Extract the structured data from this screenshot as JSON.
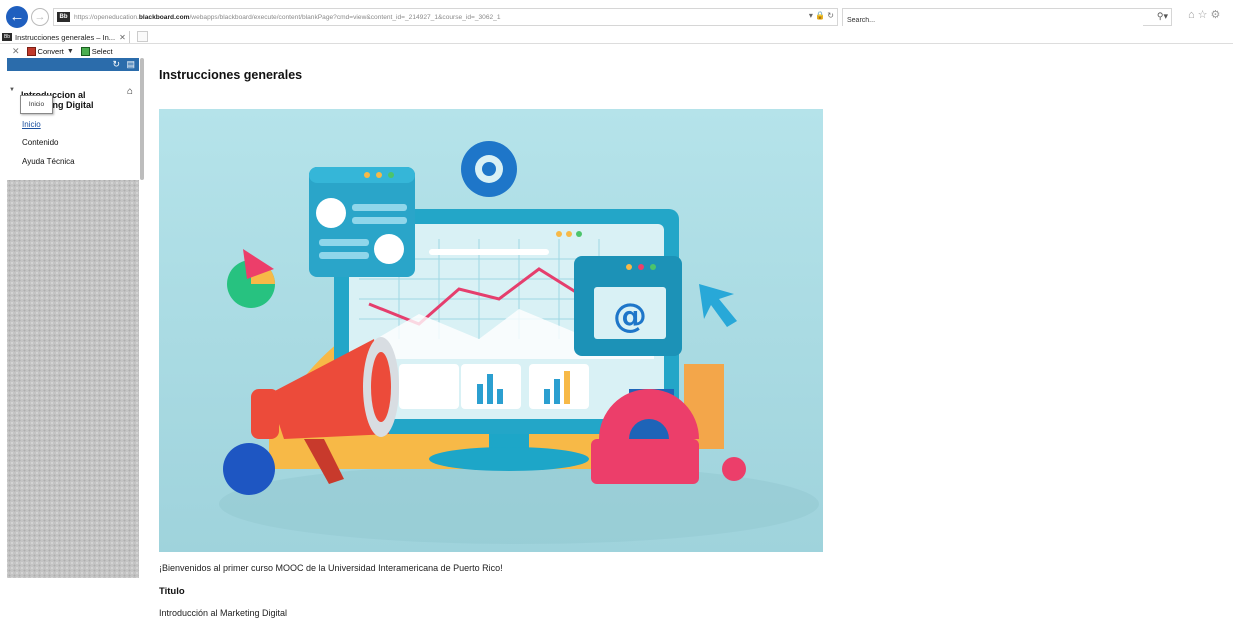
{
  "browser": {
    "url_prefix": "https://openeducation.",
    "url_domain": "blackboard.com",
    "url_path": "/webapps/blackboard/execute/content/blankPage?cmd=view&content_id=_214927_1&course_id=_3062_1",
    "search_placeholder": "Search...",
    "tab_title": "Instrucciones generales – In...",
    "favicon_text": "Bb"
  },
  "command_bar": {
    "convert_label": "Convert",
    "select_label": "Select"
  },
  "sidebar": {
    "course_title_line1": "Introduccion al",
    "course_title_line2": "Marketing Digital",
    "tooltip": "Inicio",
    "items": [
      {
        "label": "Inicio",
        "active": true
      },
      {
        "label": "Contenido",
        "active": false
      },
      {
        "label": "Ayuda Técnica",
        "active": false
      }
    ]
  },
  "content": {
    "title": "Instrucciones generales",
    "welcome_text": "¡Bienvenidos al primer curso MOOC de la Universidad Interamericana de Puerto Rico!",
    "section_label": "Titulo",
    "course_name": "Introducción al Marketing Digital",
    "hero_icon": "digital-marketing-illustration"
  },
  "colors": {
    "accent": "#2b6cab",
    "link": "#1a4f9e",
    "hero_bg": "#a8dde4"
  }
}
